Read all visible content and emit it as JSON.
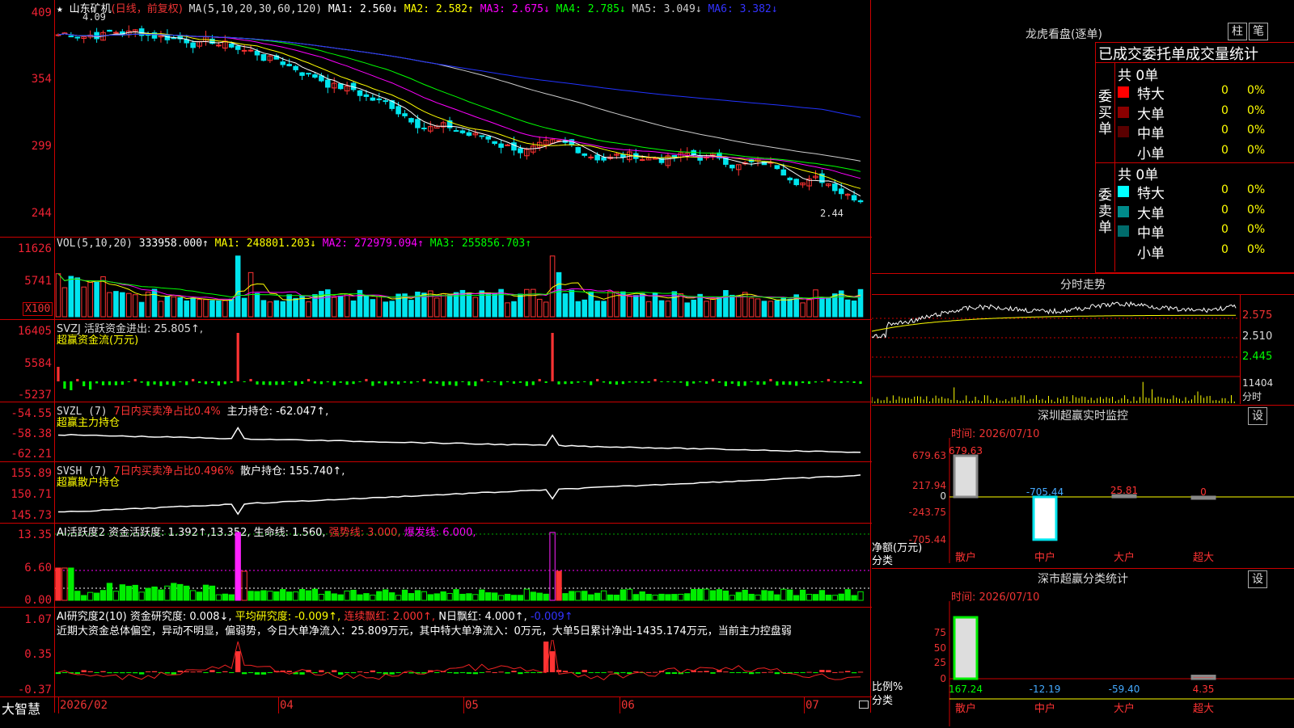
{
  "main_legend": {
    "star": "★",
    "stock": "山东矿机",
    "period": "(日线，前复权)",
    "ma_def": "MA(5,10,20,30,60,120)",
    "ma1": "MA1: 2.560↓",
    "ma2": "MA2: 2.582↑",
    "ma3": "MA3: 2.675↓",
    "ma4": "MA4: 2.785↓",
    "ma5": "MA5: 3.049↓",
    "ma6": "MA6: 3.382↓"
  },
  "price_axis": [
    "409",
    "354",
    "299",
    "244"
  ],
  "price_hi_mark": "4.09",
  "price_lo_mark": "2.44",
  "vol": {
    "legend_def": "VOL(5,10,20)",
    "value": "333958.000↑",
    "ma1": "MA1: 248801.203↓",
    "ma2": "MA2: 272979.094↑",
    "ma3": "MA3: 255856.703↑",
    "axis": [
      "11626",
      "5741"
    ],
    "unit": "X100"
  },
  "svzj": {
    "legend": "SVZJ  活跃资金进出: 25.805↑,",
    "sub": "超赢资金流(万元)",
    "axis": [
      "16405",
      "5584",
      "-5237"
    ]
  },
  "svzl": {
    "legend_a": "SVZL (7)",
    "legend_b": "7日内买卖净占比0.4%",
    "legend_c": "主力持仓: -62.047↑,",
    "sub": "超赢主力持仓",
    "axis": [
      "-54.55",
      "-58.38",
      "-62.21"
    ]
  },
  "svsh": {
    "legend_a": "SVSH (7)",
    "legend_b": "7日内买卖净占比0.496%",
    "legend_c": "散户持仓: 155.740↑,",
    "sub": "超赢散户持仓",
    "axis": [
      "155.89",
      "150.71",
      "145.73"
    ]
  },
  "ai_active": {
    "legend_a": "AI活跃度2 资金活跃度: 1.392↑,13.352,",
    "legend_b": "生命线: 1.560,",
    "legend_c": "强势线: 3.000,",
    "legend_d": "爆发线: 6.000,",
    "axis": [
      "13.35",
      "6.60",
      "0.00"
    ]
  },
  "ai_research": {
    "legend_a": "AI研究度2(10) 资金研究度: 0.008↓,",
    "legend_b": "平均研究度: -0.009↑,",
    "legend_c": "连续飘红: 2.000↑,",
    "legend_d": "N日飘红: 4.000↑,",
    "legend_e": "-0.009↑",
    "text": "近期大资金总体偏空，异动不明显，偏弱势，今日大单净流入：25.809万元，其中特大单净流入：0万元，大单5日累计净出-1435.174万元，当前主力控盘弱",
    "axis": [
      "1.07",
      "0.35",
      "-0.37"
    ]
  },
  "bottom_axis": {
    "brand": "大智慧",
    "dates": [
      "2026/02",
      "04",
      "05",
      "06",
      "07"
    ]
  },
  "dragon": {
    "title": "龙虎看盘(逐单)",
    "btn_bar": "柱",
    "btn_pen": "笔",
    "header": "已成交委托单成交量统计",
    "buy_label": "委买单",
    "sell_label": "委卖单",
    "buy_total": "共 0单",
    "sell_total": "共 0单",
    "buy_rows": [
      {
        "name": "特大",
        "num": "0",
        "pct": "0%",
        "color": "#ff0000"
      },
      {
        "name": "大单",
        "num": "0",
        "pct": "0%",
        "color": "#8b0000"
      },
      {
        "name": "中单",
        "num": "0",
        "pct": "0%",
        "color": "#5a0000"
      },
      {
        "name": "小单",
        "num": "0",
        "pct": "0%",
        "color": "#000000"
      }
    ],
    "sell_rows": [
      {
        "name": "特大",
        "num": "0",
        "pct": "0%",
        "color": "#00ffff"
      },
      {
        "name": "大单",
        "num": "0",
        "pct": "0%",
        "color": "#008b8b"
      },
      {
        "name": "中单",
        "num": "0",
        "pct": "0%",
        "color": "#006b6b"
      },
      {
        "name": "小单",
        "num": "0",
        "pct": "0%",
        "color": "#000000"
      }
    ]
  },
  "intraday": {
    "title": "分时走势",
    "axis": [
      "2.575",
      "2.510",
      "2.445"
    ],
    "vol_axis": "11404",
    "vol_unit": "分时"
  },
  "monitor": {
    "title": "深圳超赢实时监控",
    "btn": "设",
    "time": "时间: 2026/07/10",
    "y_label": "净额(万元)",
    "x_label": "分类",
    "axis": [
      "679.63",
      "217.94",
      "0",
      "-243.75",
      "-705.44"
    ],
    "categories": [
      "散户",
      "中户",
      "大户",
      "超大"
    ],
    "values": [
      679.63,
      -705.44,
      25.81,
      0
    ],
    "value_labels": [
      "679.63",
      "-705.44",
      "25.81",
      "0"
    ]
  },
  "class_stat": {
    "title": "深市超赢分类统计",
    "btn": "设",
    "time": "时间: 2026/07/10",
    "y_label": "比例%",
    "x_label": "分类",
    "axis": [
      "75",
      "50",
      "25",
      "0"
    ],
    "categories": [
      "散户",
      "中户",
      "大户",
      "超大"
    ],
    "values": [
      167.24,
      -12.19,
      -59.4,
      4.35
    ],
    "value_labels": [
      "167.24",
      "-12.19",
      "-59.40",
      "4.35"
    ]
  },
  "colors": {
    "up": "#ff3333",
    "down": "#00e5ee",
    "grid": "#c00000",
    "ma1": "#ffffff",
    "ma2": "#ffff00",
    "ma3": "#ff00ff",
    "ma4": "#00ff00",
    "ma5": "#cccccc",
    "ma6": "#2233ff"
  }
}
